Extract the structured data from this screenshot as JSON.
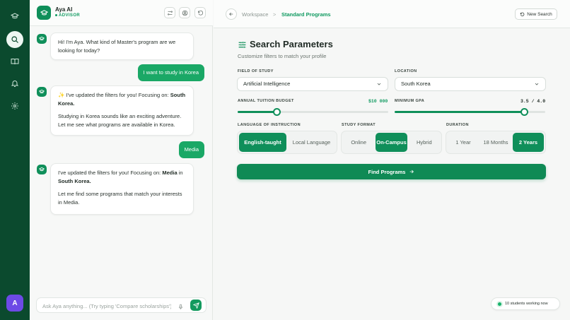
{
  "app": {
    "name": "Aya AI",
    "role": "ADVISOR"
  },
  "rail": {
    "avatar_initial": "A"
  },
  "chat": {
    "bot1": "Hi! I'm Aya. What kind of Master's program are we looking for today?",
    "user1": "I want to study in Korea",
    "bot2": {
      "p1_prefix": "✨ I've updated the filters for you! Focusing on:",
      "p1_bold": "South Korea.",
      "p2": "Studying in Korea sounds like an exciting adventure. Let me see what programs are available in Korea."
    },
    "user2": "Media",
    "bot3": {
      "p1_prefix": "I've updated the filters for you! Focusing on:",
      "p1_bold1": "Media",
      "p1_mid": "in",
      "p1_bold2": "South Korea.",
      "p2": "Let me find some programs that match your interests in Media."
    },
    "input_placeholder": "Ask Aya anything... (Try typing 'Compare scholarships')"
  },
  "breadcrumb": {
    "root": "Workspace",
    "separator": ">",
    "current": "Standard Programs"
  },
  "new_search_label": "New Search",
  "page": {
    "title": "Search Parameters",
    "subtitle": "Customize filters to match your profile"
  },
  "fields": {
    "field_of_study": {
      "label": "FIELD OF STUDY",
      "value": "Artificial Intelligence"
    },
    "location": {
      "label": "LOCATION",
      "value": "South Korea"
    },
    "budget": {
      "label": "ANNUAL TUITION BUDGET",
      "value_text": "$10 000",
      "fraction": 0.26
    },
    "gpa": {
      "label": "MINIMUM GPA",
      "value_text": "3.5 / 4.0",
      "fraction": 0.857
    },
    "language": {
      "label": "LANGUAGE OF INSTRUCTION",
      "options": [
        "English-taught",
        "Local Language"
      ],
      "selected": 0
    },
    "format": {
      "label": "STUDY FORMAT",
      "options": [
        "Online",
        "On-Campus",
        "Hybrid"
      ],
      "selected": 1
    },
    "duration": {
      "label": "DURATION",
      "options": [
        "1 Year",
        "18 Months",
        "2 Years"
      ],
      "selected": 2
    }
  },
  "find_button": "Find Programs",
  "status": "10 students working now",
  "colors": {
    "brand": "#0f8f5a",
    "rail": "#0b4a2e",
    "user_bubble": "#1aa866",
    "budget_value": "#0f9a60",
    "avatar": "#6d4ae6"
  },
  "icons": [
    "graduation-cap-icon",
    "search-icon",
    "book-icon",
    "bell-icon",
    "gear-icon",
    "filter-icon",
    "user-circle-icon",
    "refresh-icon",
    "mic-icon",
    "send-icon",
    "arrow-left-icon",
    "arrow-right-icon",
    "chevron-down-icon",
    "sliders-icon"
  ]
}
